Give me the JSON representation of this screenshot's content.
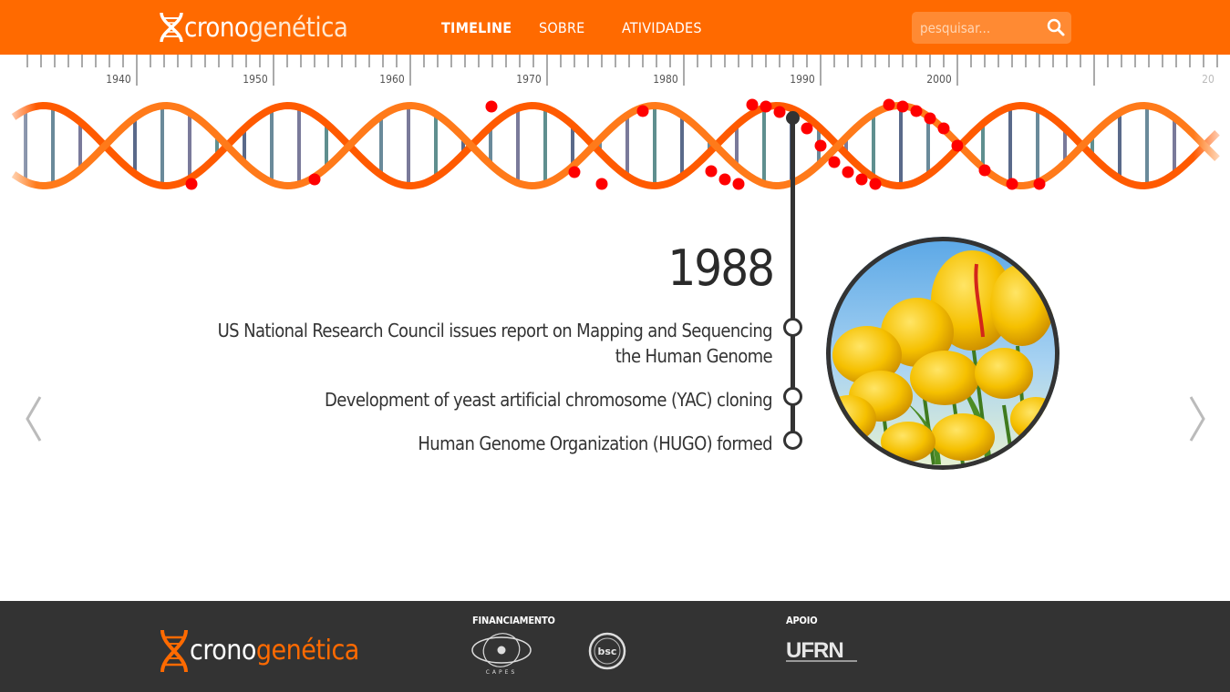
{
  "header": {
    "logo": {
      "part1": "crono",
      "part2": "genética"
    },
    "nav": [
      {
        "label": "TIMELINE",
        "active": true
      },
      {
        "label": "SOBRE",
        "active": false
      },
      {
        "label": "ATIVIDADES",
        "active": false
      }
    ],
    "search": {
      "placeholder": "pesquisar..."
    }
  },
  "ruler": {
    "labels": [
      "1940",
      "1950",
      "1960",
      "1970",
      "1980",
      "1990",
      "2000",
      "20"
    ]
  },
  "event": {
    "year": "1988",
    "items": [
      "US National Research Council issues report on Mapping and Sequencing the Human Genome",
      "Development of yeast artificial chromosome (YAC) cloning",
      "Human Genome Organization (HUGO) formed"
    ]
  },
  "footer": {
    "logo": {
      "part1": "crono",
      "part2": "genética"
    },
    "financiamento_label": "FINANCIAMENTO",
    "apoio_label": "APOIO",
    "capes_text": "CAPES",
    "bsc_text": "bsc",
    "ufrn_text": "UFRN"
  },
  "colors": {
    "brand": "#ff6a00",
    "footer": "#333333",
    "marker": "#ff0000",
    "text": "#333333"
  },
  "icons": [
    "dna-logo-icon",
    "search-icon",
    "chevron-left-icon",
    "chevron-right-icon",
    "capes-logo-icon",
    "bsc-logo-icon",
    "ufrn-logo-icon"
  ]
}
